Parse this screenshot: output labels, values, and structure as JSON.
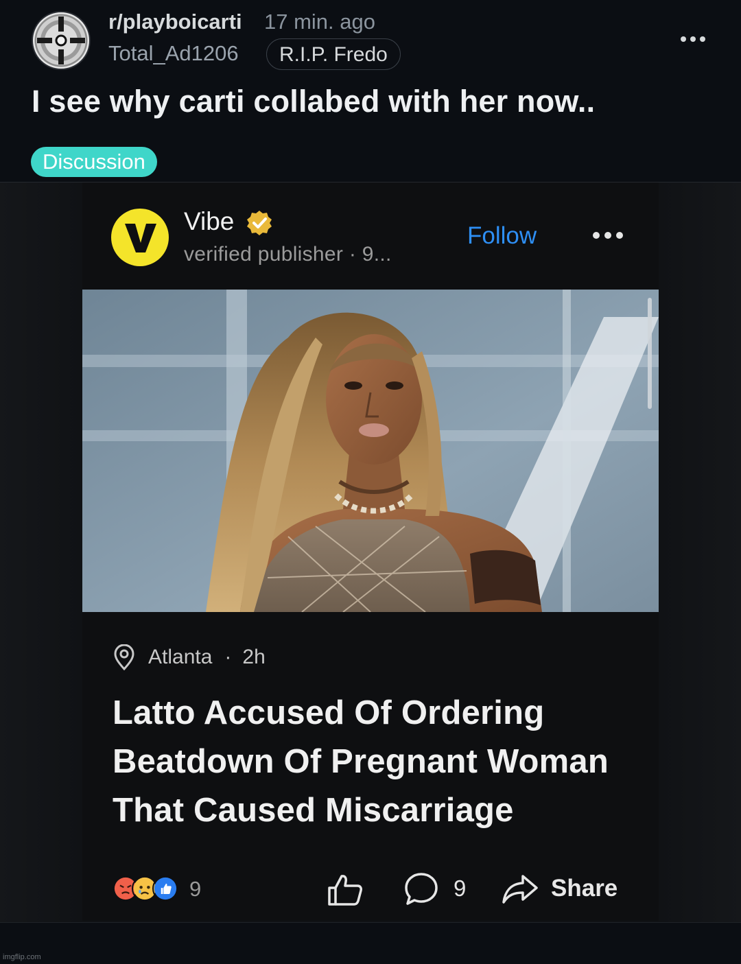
{
  "post": {
    "subreddit": "r/playboicarti",
    "time_ago": "17 min. ago",
    "author": "Total_Ad1206",
    "author_flair": "R.I.P. Fredo",
    "title": "I see why carti collabed with her now..",
    "tag": "Discussion",
    "icons": {
      "avatar": "vinyl-record-icon",
      "more": "ellipsis-icon"
    },
    "colors": {
      "tag_background": "#3fd6c9",
      "background": "#0b0e13"
    }
  },
  "embed": {
    "publisher_name": "Vibe",
    "publisher_logo_letter": "V",
    "publisher_meta": "verified publisher · 9...",
    "follow_label": "Follow",
    "location": "Atlanta",
    "location_separator": "·",
    "time_ago": "2h",
    "headline": "Latto Accused Of Ordering Beatdown Of Pregnant Woman That Caused Miscarriage",
    "reaction_count": "9",
    "comment_count": "9",
    "share_label": "Share",
    "icons": {
      "verified": "verified-badge-icon",
      "location": "location-pin-icon",
      "like": "thumbs-up-icon",
      "comment": "comment-bubble-icon",
      "share": "share-arrow-icon",
      "reactions": [
        "angry-reaction-icon",
        "sad-reaction-icon",
        "like-reaction-icon"
      ]
    },
    "colors": {
      "follow": "#2e8ff5",
      "logo": "#f4e42a",
      "verified": "#e9b93a"
    }
  },
  "watermark": "imgflip.com"
}
